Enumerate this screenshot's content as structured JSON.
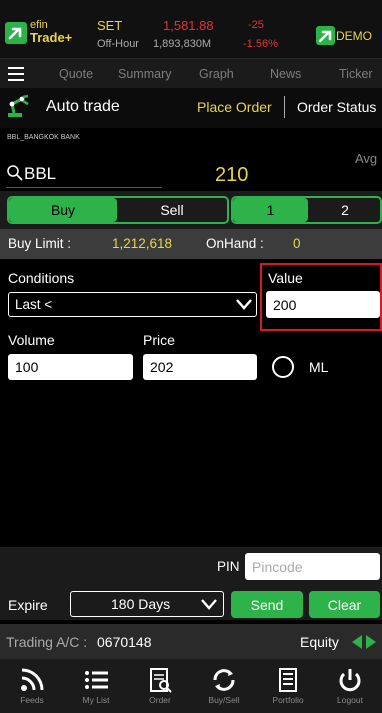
{
  "header": {
    "brand_top": "efin",
    "brand_bottom": "Trade+",
    "market": "SET",
    "session": "Off-Hour",
    "index_value": "1,581.88",
    "volume": "1,893,830M",
    "change": "-25",
    "change_pct": "-1.56%",
    "demo_label": "DEMO"
  },
  "menu": {
    "items": [
      "Quote",
      "Summary",
      "Graph",
      "News",
      "Ticker"
    ]
  },
  "autotrade": {
    "label": "Auto trade",
    "place_order": "Place Order",
    "order_status": "Order Status",
    "stock_full_name": "BBL_BANGKOK BANK",
    "avg_label": "Avg"
  },
  "search": {
    "symbol": "BBL",
    "price": "210"
  },
  "side_toggle": {
    "buy": "Buy",
    "sell": "Sell",
    "selected": "Buy"
  },
  "slot_toggle": {
    "one": "1",
    "two": "2",
    "selected": "1"
  },
  "limits": {
    "buy_limit_label": "Buy Limit :",
    "buy_limit_value": "1,212,618",
    "onhand_label": "OnHand :",
    "onhand_value": "0"
  },
  "conditions": {
    "label": "Conditions",
    "selected": "Last <",
    "value_label": "Value",
    "value": "200"
  },
  "order": {
    "volume_label": "Volume",
    "volume": "100",
    "price_label": "Price",
    "price": "202",
    "ml_label": "ML"
  },
  "footer_form": {
    "pin_label": "PIN",
    "pin_placeholder": "Pincode",
    "expire_label": "Expire",
    "expire_value": "180 Days",
    "send_label": "Send",
    "clear_label": "Clear"
  },
  "account": {
    "label": "Trading A/C :",
    "number": "0670148",
    "type": "Equity"
  },
  "bottom_nav": {
    "items": [
      "Feeds",
      "My List",
      "Order",
      "Buy/Sell",
      "Portfolio",
      "Logout"
    ]
  },
  "colors": {
    "green": "#2db34a",
    "yellow": "#e8d54a",
    "red": "#e0323a",
    "highlight_box": "#d81a1a"
  }
}
